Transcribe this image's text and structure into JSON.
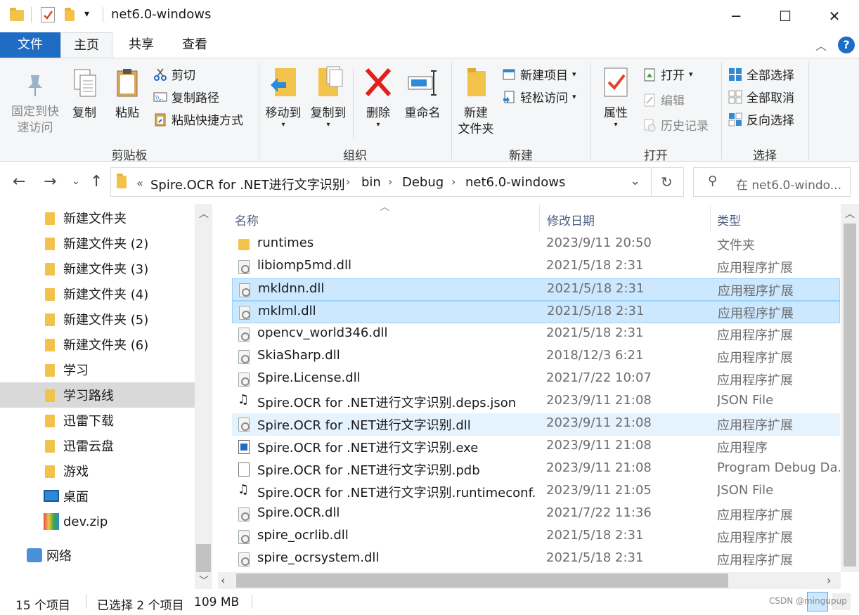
{
  "window": {
    "title": "net6.0-windows",
    "minimize": "─",
    "maximize": "☐",
    "close": "✕"
  },
  "tabs": {
    "file": "文件",
    "home": "主页",
    "share": "共享",
    "view": "查看"
  },
  "help": "?",
  "ribbon": {
    "clipboard": {
      "label": "剪贴板",
      "pin": "固定到快\n速访问",
      "pin_1": "固定到快",
      "pin_2": "速访问",
      "copy": "复制",
      "paste": "粘贴",
      "cut": "剪切",
      "copy_path": "复制路径",
      "paste_shortcut": "粘贴快捷方式"
    },
    "organize": {
      "label": "组织",
      "move_to": "移动到",
      "copy_to": "复制到",
      "delete": "删除",
      "rename": "重命名"
    },
    "new": {
      "label": "新建",
      "new_folder_1": "新建",
      "new_folder_2": "文件夹",
      "new_item": "新建项目",
      "easy_access": "轻松访问"
    },
    "open": {
      "label": "打开",
      "properties": "属性",
      "open": "打开",
      "edit": "编辑",
      "history": "历史记录"
    },
    "select": {
      "label": "选择",
      "select_all": "全部选择",
      "select_none": "全部取消",
      "invert": "反向选择"
    }
  },
  "address": {
    "overflow": "«",
    "crumbs": [
      "Spire.OCR for .NET进行文字识别",
      "bin",
      "Debug",
      "net6.0-windows"
    ],
    "search_placeholder": "在 net6.0-windo..."
  },
  "nav_items": [
    {
      "label": "新建文件夹",
      "icon": "folder-icon"
    },
    {
      "label": "新建文件夹 (2)",
      "icon": "folder-icon"
    },
    {
      "label": "新建文件夹 (3)",
      "icon": "folder-icon"
    },
    {
      "label": "新建文件夹 (4)",
      "icon": "folder-icon"
    },
    {
      "label": "新建文件夹 (5)",
      "icon": "folder-icon"
    },
    {
      "label": "新建文件夹 (6)",
      "icon": "folder-icon"
    },
    {
      "label": "学习",
      "icon": "folder-icon"
    },
    {
      "label": "学习路线",
      "icon": "folder-icon",
      "selected": true
    },
    {
      "label": "迅雷下载",
      "icon": "folder-icon"
    },
    {
      "label": "迅雷云盘",
      "icon": "folder-icon"
    },
    {
      "label": "游戏",
      "icon": "folder-icon"
    },
    {
      "label": "桌面",
      "icon": "desktop-icon"
    },
    {
      "label": "dev.zip",
      "icon": "zip-icon"
    },
    {
      "label": "网络",
      "icon": "network-icon"
    }
  ],
  "columns": {
    "name": "名称",
    "date": "修改日期",
    "type": "类型"
  },
  "files": [
    {
      "name": "runtimes",
      "date": "2023/9/11 20:50",
      "type": "文件夹",
      "icon": "folder"
    },
    {
      "name": "libiomp5md.dll",
      "date": "2021/5/18 2:31",
      "type": "应用程序扩展",
      "icon": "dll"
    },
    {
      "name": "mkldnn.dll",
      "date": "2021/5/18 2:31",
      "type": "应用程序扩展",
      "icon": "dll",
      "state": "selected"
    },
    {
      "name": "mklml.dll",
      "date": "2021/5/18 2:31",
      "type": "应用程序扩展",
      "icon": "dll",
      "state": "selected"
    },
    {
      "name": "opencv_world346.dll",
      "date": "2021/5/18 2:31",
      "type": "应用程序扩展",
      "icon": "dll"
    },
    {
      "name": "SkiaSharp.dll",
      "date": "2018/12/3 6:21",
      "type": "应用程序扩展",
      "icon": "dll"
    },
    {
      "name": "Spire.License.dll",
      "date": "2021/7/22 10:07",
      "type": "应用程序扩展",
      "icon": "dll"
    },
    {
      "name": "Spire.OCR for .NET进行文字识别.deps.json",
      "date": "2023/9/11 21:08",
      "type": "JSON File",
      "icon": "json"
    },
    {
      "name": "Spire.OCR for .NET进行文字识别.dll",
      "date": "2023/9/11 21:08",
      "type": "应用程序扩展",
      "icon": "dll",
      "state": "hover"
    },
    {
      "name": "Spire.OCR for .NET进行文字识别.exe",
      "date": "2023/9/11 21:08",
      "type": "应用程序",
      "icon": "exe"
    },
    {
      "name": "Spire.OCR for .NET进行文字识别.pdb",
      "date": "2023/9/11 21:08",
      "type": "Program Debug Da...",
      "icon": "pdb"
    },
    {
      "name": "Spire.OCR for .NET进行文字识别.runtimeconf...",
      "date": "2023/9/11 21:05",
      "type": "JSON File",
      "icon": "json"
    },
    {
      "name": "Spire.OCR.dll",
      "date": "2021/7/22 11:36",
      "type": "应用程序扩展",
      "icon": "dll"
    },
    {
      "name": "spire_ocrlib.dll",
      "date": "2021/5/18 2:31",
      "type": "应用程序扩展",
      "icon": "dll"
    },
    {
      "name": "spire_ocrsystem.dll",
      "date": "2021/5/18 2:31",
      "type": "应用程序扩展",
      "icon": "dll"
    }
  ],
  "status": {
    "count": "15 个项目",
    "selected": "已选择 2 个项目",
    "size": "109 MB"
  },
  "watermark": "CSDN @mingupup"
}
